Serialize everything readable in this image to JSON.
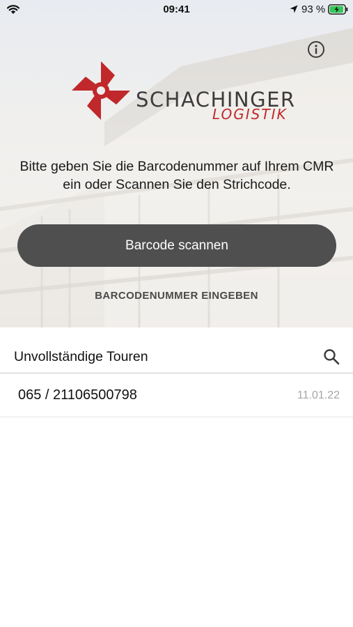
{
  "status_bar": {
    "time": "09:41",
    "battery_percent": "93 %",
    "battery_level": 0.93,
    "icons": [
      "wifi-icon",
      "location-arrow-icon",
      "battery-charging-icon"
    ]
  },
  "header": {
    "info_icon": "info-circle-icon",
    "logo": {
      "wordmark": "SCHACHINGER",
      "subline": "LOGISTIK"
    }
  },
  "main": {
    "instruction": "Bitte geben Sie die Barcodenummer auf Ihrem CMR ein oder Scannen Sie den Strichcode.",
    "scan_button": "Barcode scannen",
    "enter_button": "BARCODENUMMER EINGEBEN"
  },
  "tours": {
    "title": "Unvollständige Touren",
    "search_icon": "search-icon",
    "items": [
      {
        "label": "065 / 21106500798",
        "date": "11.01.22"
      }
    ]
  },
  "colors": {
    "brand_red": "#c0282b",
    "button_bg": "#4f4f4f",
    "text_dark": "#1c1c1e",
    "muted": "#a5a5a5"
  }
}
